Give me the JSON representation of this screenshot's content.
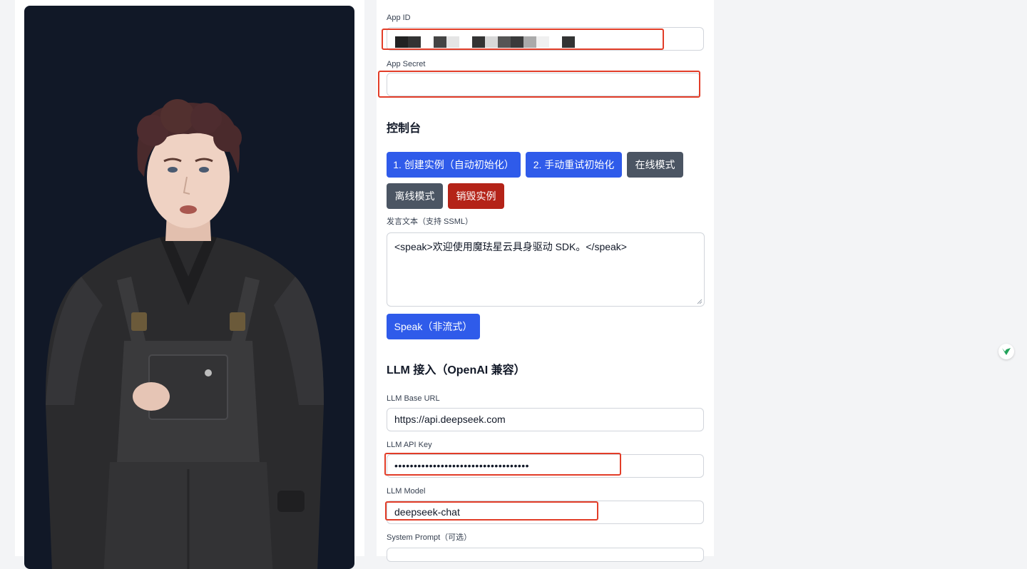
{
  "app_id": {
    "label": "App ID",
    "value_redacted": true
  },
  "app_secret": {
    "label": "App Secret",
    "value": ""
  },
  "console": {
    "title": "控制台",
    "buttons": {
      "create_instance": "1. 创建实例（自动初始化）",
      "manual_retry_init": "2. 手动重试初始化",
      "online_mode": "在线模式",
      "offline_mode": "离线模式",
      "destroy_instance": "销毁实例"
    },
    "speech_text_label": "发言文本（支持 SSML）",
    "speech_text_value": "<speak>欢迎使用魔珐星云具身驱动 SDK。</speak>",
    "speak_button": "Speak（非流式）"
  },
  "llm": {
    "title": "LLM 接入（OpenAI 兼容）",
    "base_url_label": "LLM Base URL",
    "base_url_value": "https://api.deepseek.com",
    "api_key_label": "LLM API Key",
    "api_key_value": "•••••••••••••••••••••••••••••••••••",
    "model_label": "LLM Model",
    "model_value": "deepseek-chat",
    "system_prompt_label": "System Prompt（可选）"
  },
  "colors": {
    "primary_button": "#2f5bea",
    "secondary_button": "#4b5563",
    "danger_button": "#b42318",
    "annotation_box": "#e23d28",
    "avatar_background": "#111827"
  },
  "icons": {
    "floating_badge": "assistant-logo-icon"
  }
}
